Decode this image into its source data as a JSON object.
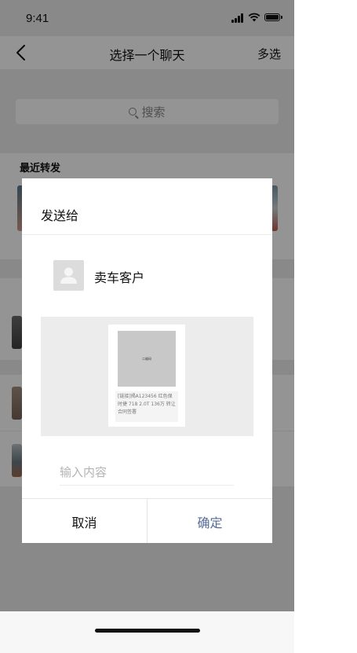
{
  "status_bar": {
    "time": "9:41"
  },
  "nav": {
    "title": "选择一个聊天",
    "multi_select": "多选"
  },
  "search": {
    "label": "搜索"
  },
  "recent": {
    "label": "最近转发"
  },
  "dialog": {
    "title": "发送给",
    "recipient": {
      "name": "卖车客户"
    },
    "preview": {
      "qr_label": "二维码",
      "description": "[链接]揭A123456 红色保时捷 718 2.0T 136万 转让合同签署"
    },
    "input_placeholder": "输入内容",
    "cancel_label": "取消",
    "confirm_label": "确定"
  },
  "colors": {
    "confirm": "#576b95",
    "overlay": "rgba(0,0,0,0.42)"
  }
}
